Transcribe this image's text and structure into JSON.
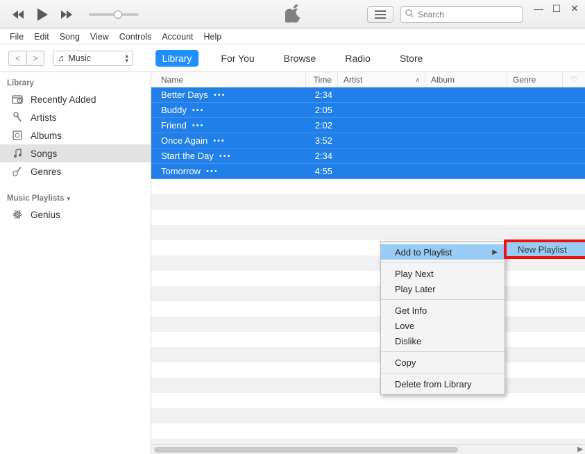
{
  "search": {
    "placeholder": "Search"
  },
  "menubar": [
    "File",
    "Edit",
    "Song",
    "View",
    "Controls",
    "Account",
    "Help"
  ],
  "source_selector": {
    "label": "Music"
  },
  "tabs": [
    {
      "label": "Library",
      "active": true
    },
    {
      "label": "For You"
    },
    {
      "label": "Browse"
    },
    {
      "label": "Radio"
    },
    {
      "label": "Store"
    }
  ],
  "sidebar": {
    "library_header": "Library",
    "items": [
      {
        "label": "Recently Added",
        "icon": "clock"
      },
      {
        "label": "Artists",
        "icon": "mic"
      },
      {
        "label": "Albums",
        "icon": "album"
      },
      {
        "label": "Songs",
        "icon": "note",
        "active": true
      },
      {
        "label": "Genres",
        "icon": "guitar"
      }
    ],
    "playlists_header": "Music Playlists",
    "playlists": [
      {
        "label": "Genius",
        "icon": "atom"
      }
    ]
  },
  "columns": {
    "name": "Name",
    "time": "Time",
    "artist": "Artist",
    "album": "Album",
    "genre": "Genre"
  },
  "songs": [
    {
      "name": "Better Days",
      "time": "2:34"
    },
    {
      "name": "Buddy",
      "time": "2:05"
    },
    {
      "name": "Friend",
      "time": "2:02"
    },
    {
      "name": "Once Again",
      "time": "3:52"
    },
    {
      "name": "Start the Day",
      "time": "2:34"
    },
    {
      "name": "Tomorrow",
      "time": "4:55"
    }
  ],
  "context_menu": {
    "items": [
      {
        "label": "Add to Playlist",
        "hover": true,
        "submenu": true
      },
      null,
      {
        "label": "Play Next"
      },
      {
        "label": "Play Later"
      },
      null,
      {
        "label": "Get Info"
      },
      {
        "label": "Love"
      },
      {
        "label": "Dislike"
      },
      null,
      {
        "label": "Copy"
      },
      null,
      {
        "label": "Delete from Library"
      }
    ],
    "submenu_label": "New Playlist"
  }
}
